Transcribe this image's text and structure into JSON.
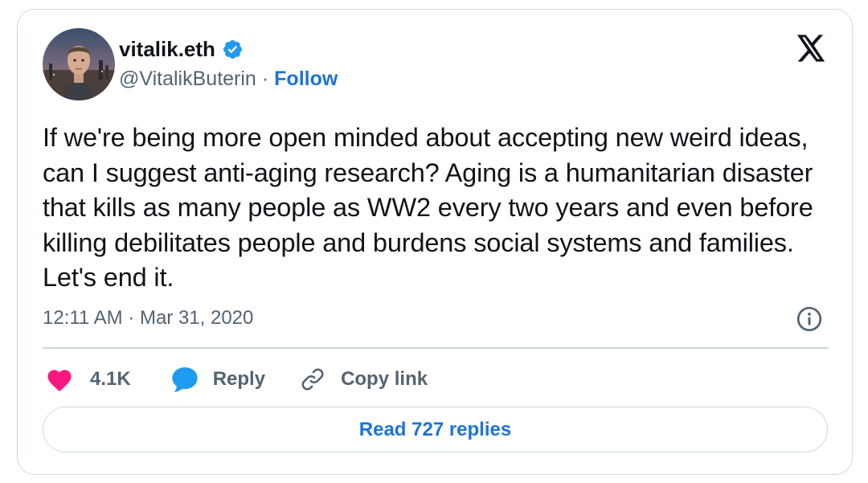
{
  "author": {
    "display_name": "vitalik.eth",
    "handle": "@VitalikButerin",
    "separator": "·",
    "follow_label": "Follow"
  },
  "tweet": {
    "text": "If we're being more open minded about accepting new weird ideas, can I suggest anti-aging research? Aging is a humanitarian disaster that kills as many people as WW2 every two years and even before killing debilitates people and burdens social systems and families. Let's end it.",
    "timestamp": "12:11 AM · Mar 31, 2020"
  },
  "actions": {
    "like_count": "4.1K",
    "reply_label": "Reply",
    "copy_link_label": "Copy link"
  },
  "read_replies_label": "Read 727 replies",
  "icons": {
    "brand": "x-logo-icon",
    "verified": "verified-badge-icon",
    "info": "info-icon",
    "like": "heart-icon",
    "reply": "speech-bubble-icon",
    "copy_link": "link-icon"
  },
  "colors": {
    "link_blue": "#1d73d6",
    "verified_blue": "#1d9bf0",
    "heart_pink": "#f91880",
    "muted_text": "#536471",
    "border": "#cfd9de"
  }
}
